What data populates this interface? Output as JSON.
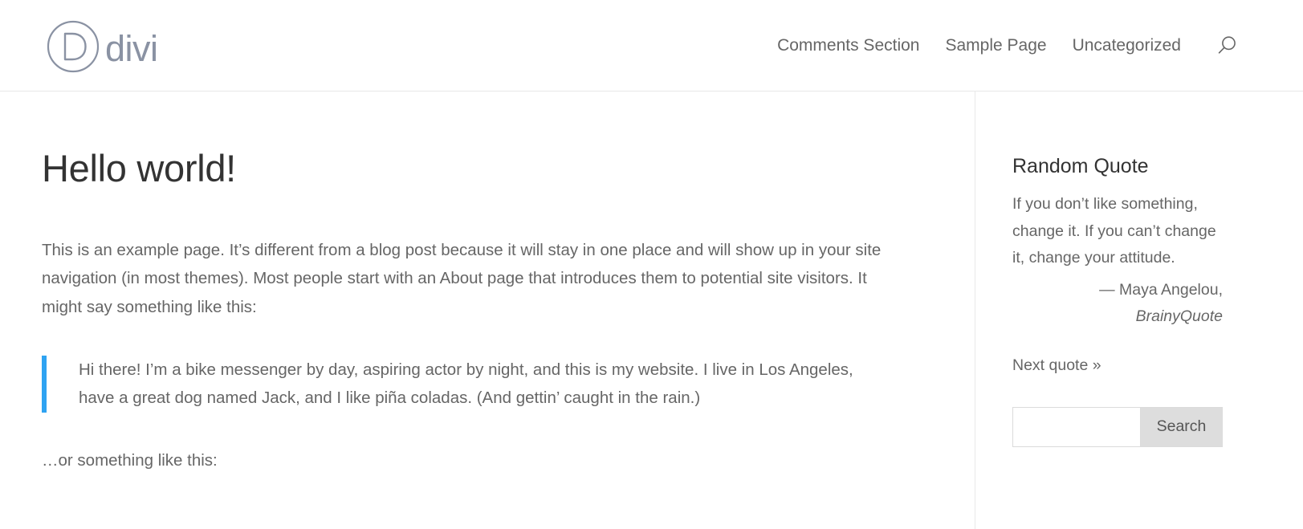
{
  "header": {
    "logo": {
      "mark_icon": "divi-circle-d-icon",
      "wordmark": "divi"
    },
    "nav_items": [
      {
        "label": "Comments Section"
      },
      {
        "label": "Sample Page"
      },
      {
        "label": "Uncategorized"
      }
    ],
    "search_icon": "search-icon"
  },
  "content": {
    "title": "Hello world!",
    "paragraph_1": "This is an example page. It’s different from a blog post because it will stay in one place and will show up in your site navigation (in most themes). Most people start with an About page that introduces them to potential site visitors. It might say something like this:",
    "blockquote": "Hi there! I’m a bike messenger by day, aspiring actor by night, and this is my website. I live in Los Angeles, have a great dog named Jack, and I like piña coladas. (And gettin’ caught in the rain.)",
    "paragraph_2": "…or something like this:"
  },
  "sidebar": {
    "random_quote": {
      "title": "Random Quote",
      "quote": "If you don’t like something, change it. If you can’t change it, change your attitude.",
      "author": "— Maya Angelou,",
      "source": "BrainyQuote",
      "next_link": "Next quote »"
    },
    "search": {
      "value": "",
      "placeholder": "",
      "button_label": "Search"
    }
  },
  "colors": {
    "accent_blue": "#2ea3f2",
    "logo_gray": "#8a92a3",
    "text_gray": "#666666",
    "heading_gray": "#333333",
    "border_gray": "#e8e8e8",
    "button_gray": "#dddddd"
  }
}
